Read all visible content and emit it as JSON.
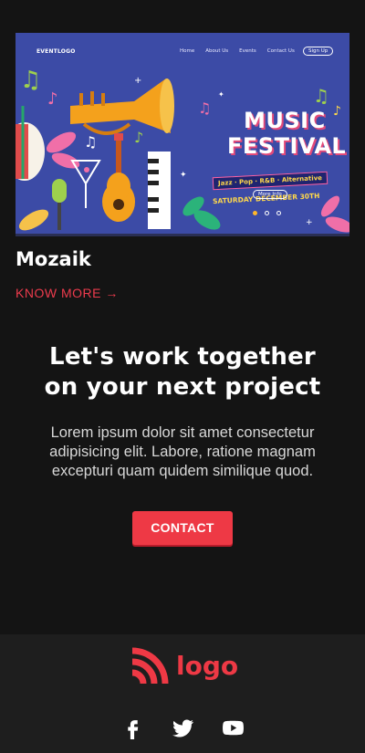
{
  "portfolio_item": {
    "image": {
      "nav": {
        "logo": "EVENTLOGO",
        "links": [
          "Home",
          "About Us",
          "Events",
          "Contact Us"
        ],
        "signup": "Sign Up"
      },
      "title_line1": "MUSIC",
      "title_line2": "FESTIVAL",
      "genres": "Jazz · Pop · R&B · Alternative",
      "date": "SATURDAY DECEMBER 30TH",
      "more_info": "More Info",
      "colors": {
        "background": "#3c4ba6",
        "accent_pink": "#e34a7a",
        "accent_yellow": "#ffd84a",
        "accent_orange": "#ffb62b"
      }
    },
    "title": "Mozaik",
    "link_label": "KNOW MORE →"
  },
  "cta": {
    "heading_line1": "Let's work together",
    "heading_line2": "on your next project",
    "body": "Lorem ipsum dolor sit amet consectetur adipisicing elit. Labore, ratione magnam excepturi quam quidem similique quod.",
    "button_label": "CONTACT",
    "button_color": "#ee3945"
  },
  "footer": {
    "logo_text": "logo",
    "logo_icon": "rss-arc-icon",
    "brand_color": "#ee3945",
    "social_icons": [
      "facebook-icon",
      "twitter-icon",
      "youtube-icon"
    ]
  }
}
